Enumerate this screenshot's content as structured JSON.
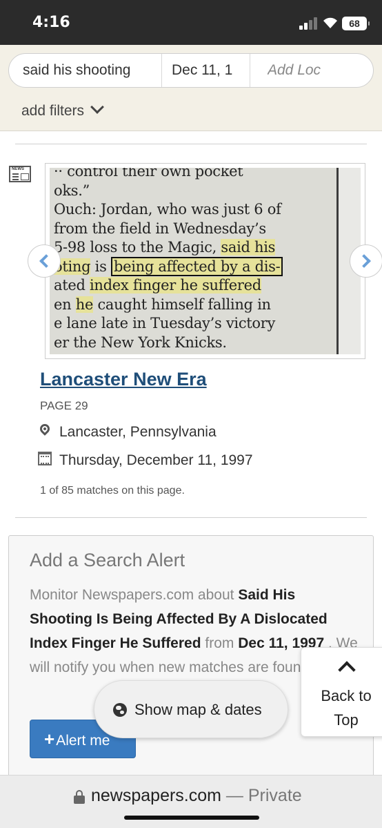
{
  "status_bar": {
    "time": "4:16",
    "battery": "68"
  },
  "search": {
    "query": "said his shooting",
    "date": "Dec 11, 1",
    "location_placeholder": "Add Loc",
    "filters_label": "add filters"
  },
  "result": {
    "clip_lines": [
      {
        "pre": "·· control their own pocket",
        "hl1": "",
        "mid": "",
        "boxed": "",
        "post": ""
      },
      {
        "pre": "oks.”",
        "hl1": "",
        "mid": "",
        "boxed": "",
        "post": ""
      },
      {
        "pre": "Ouch: Jordan, who was just 6 of",
        "hl1": "",
        "mid": "",
        "boxed": "",
        "post": ""
      },
      {
        "pre": " from the field in Wednesday’s",
        "hl1": "",
        "mid": "",
        "boxed": "",
        "post": ""
      },
      {
        "pre": "5-98 loss to the Magic, ",
        "hl1": "said his",
        "mid": "",
        "boxed": "",
        "post": ""
      },
      {
        "pre": "",
        "hl1": "oting",
        "mid": " is ",
        "boxed": "being affected by a dis-",
        "post": ""
      },
      {
        "pre": "ated ",
        "hl1": "index finger he suffered",
        "mid": "",
        "boxed": "",
        "post": ""
      },
      {
        "pre": "en ",
        "hl1": "he",
        "mid": " caught himself falling in",
        "boxed": "",
        "post": ""
      },
      {
        "pre": "e lane late in Tuesday’s victory",
        "hl1": "",
        "mid": "",
        "boxed": "",
        "post": ""
      },
      {
        "pre": "er the New York Knicks.",
        "hl1": "",
        "mid": "",
        "boxed": "",
        "post": ""
      }
    ],
    "publication": "Lancaster New Era",
    "page": "PAGE 29",
    "location": "Lancaster, Pennsylvania",
    "date": "Thursday, December 11, 1997",
    "matches": "1 of 85 matches on this page."
  },
  "alert": {
    "title": "Add a Search Alert",
    "text_intro": "Monitor Newspapers.com about ",
    "text_query": "Said His Shooting Is Being Affected By A Dislocated Index Finger He Suffered",
    "text_from": " from ",
    "text_date": "Dec 11, 1997",
    "text_notify": " . We will notify you when new matches are found.",
    "button_label": "Alert me"
  },
  "floating": {
    "map_label": "Show map & dates",
    "back_to_top": "Back to Top"
  },
  "url_bar": {
    "domain": "newspapers.com",
    "private": " — Private"
  }
}
